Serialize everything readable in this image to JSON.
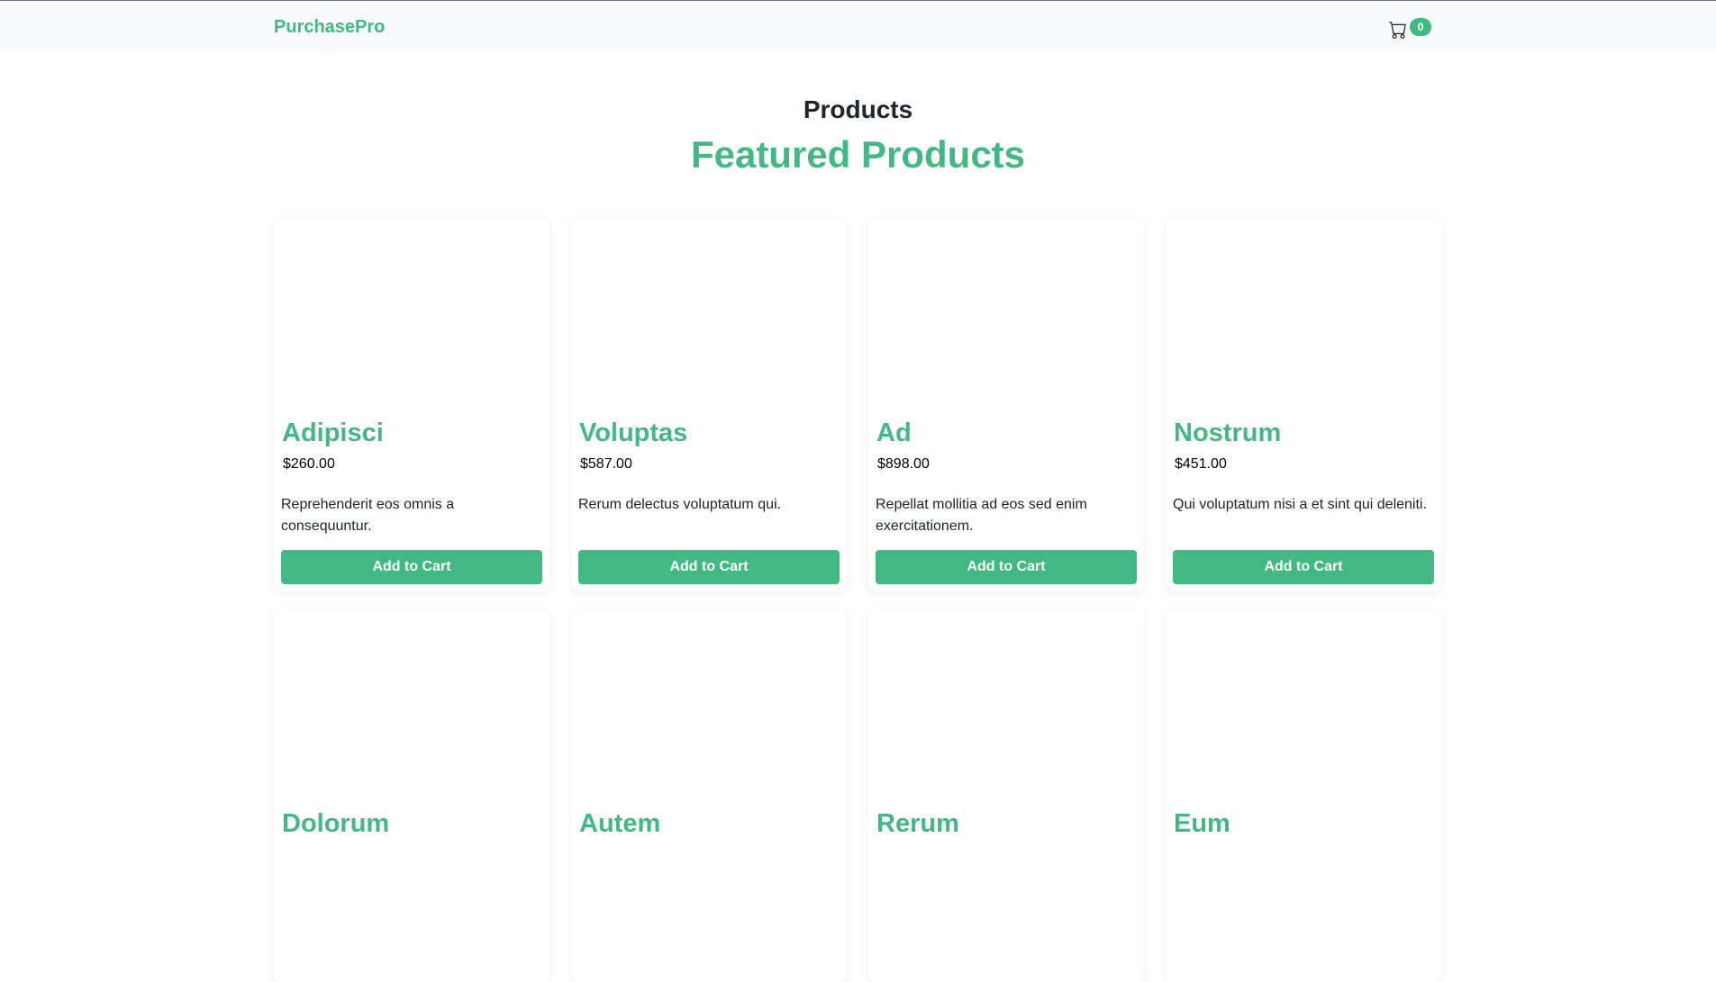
{
  "navbar": {
    "brand": "PurchasePro",
    "cart_icon": "cart-icon",
    "cart_count": "0"
  },
  "page": {
    "section_title": "Products",
    "featured_title": "Featured Products"
  },
  "colors": {
    "accent": "#42b983",
    "navbar_bg": "#f8f9fa"
  },
  "products": [
    {
      "name": "Adipisci",
      "price": "$260.00",
      "description": "Reprehenderit eos omnis a consequuntur.",
      "button": "Add to Cart"
    },
    {
      "name": "Voluptas",
      "price": "$587.00",
      "description": "Rerum delectus voluptatum qui.",
      "button": "Add to Cart"
    },
    {
      "name": "Ad",
      "price": "$898.00",
      "description": "Repellat mollitia ad eos sed enim exercitationem.",
      "button": "Add to Cart"
    },
    {
      "name": "Nostrum",
      "price": "$451.00",
      "description": "Qui voluptatum nisi a et sint qui deleniti.",
      "button": "Add to Cart"
    },
    {
      "name": "Dolorum"
    },
    {
      "name": "Autem"
    },
    {
      "name": "Rerum"
    },
    {
      "name": "Eum"
    }
  ]
}
